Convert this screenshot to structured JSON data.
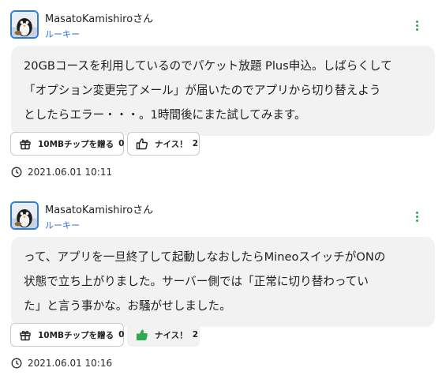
{
  "colors": {
    "accent_green": "#2eaa4f",
    "rank_blue": "#2f6fd6",
    "bubble_bg": "#f1f2f1"
  },
  "posts": [
    {
      "username": "MasatoKamishiroさん",
      "rank": "ルーキー",
      "lines": [
        "20GBコースを利用しているのでパケット放題 Plus申込。しばらくして",
        "「オプション変更完了メール」が届いたのでアプリから切り替えよう",
        "としたらエラー・・・。1時間後にまた試してみます。"
      ],
      "gift_label": "10MBチップを贈る",
      "gift_count": "0",
      "nice_label": "ナイス！",
      "nice_count": "2",
      "nice_active": false,
      "timestamp": "2021.06.01 10:11"
    },
    {
      "username": "MasatoKamishiroさん",
      "rank": "ルーキー",
      "lines": [
        "って、アプリを一旦終了して起動しなおしたらMineoスイッチがONの",
        "状態で立ち上がりました。サーバー側では「正常に切り替わってい",
        "た」と言う事かな。お騒がせしました。"
      ],
      "gift_label": "10MBチップを贈る",
      "gift_count": "0",
      "nice_label": "ナイス！",
      "nice_count": "2",
      "nice_active": true,
      "timestamp": "2021.06.01 10:16"
    }
  ],
  "icons": {
    "more": "more-vertical-icon",
    "gift": "gift-icon",
    "thumb": "thumbs-up-icon",
    "clock": "clock-icon"
  }
}
